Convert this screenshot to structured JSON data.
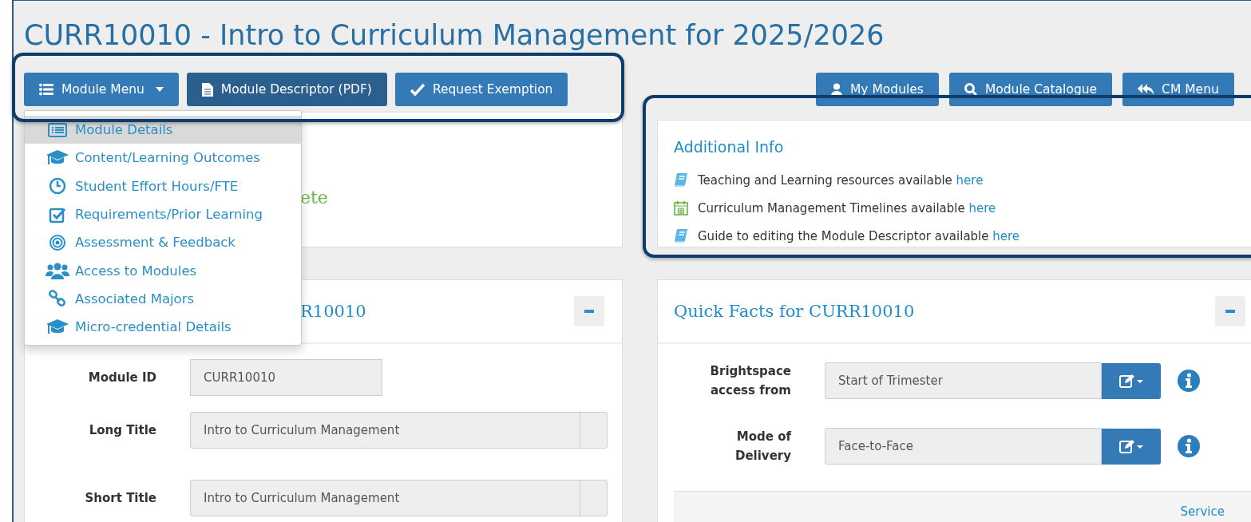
{
  "title": "CURR10010 - Intro to Curriculum Management for 2025/2026",
  "module_menu": {
    "label": "Module Menu",
    "expanded": true,
    "items": [
      {
        "label": "Module Details",
        "selected": true
      },
      {
        "label": "Content/Learning Outcomes",
        "selected": false
      },
      {
        "label": "Student Effort Hours/FTE",
        "selected": false
      },
      {
        "label": "Requirements/Prior Learning",
        "selected": false
      },
      {
        "label": "Assessment & Feedback",
        "selected": false
      },
      {
        "label": "Access to Modules",
        "selected": false
      },
      {
        "label": "Associated Majors",
        "selected": false
      },
      {
        "label": "Micro-credential Details",
        "selected": false
      }
    ]
  },
  "toolbar_buttons": [
    {
      "label": "Module Descriptor (PDF)",
      "active": true
    },
    {
      "label": "Request Exemption",
      "active": false
    }
  ],
  "nav_buttons": [
    {
      "label": "My Modules"
    },
    {
      "label": "Module Catalogue"
    },
    {
      "label": "CM Menu"
    }
  ],
  "status_card": {
    "text": "ete"
  },
  "details_panel": {
    "heading": "R10010",
    "fields": [
      {
        "label": "Module ID",
        "value": "CURR10010",
        "kind": "short"
      },
      {
        "label": "Long Title",
        "value": "Intro to Curriculum Management",
        "kind": "addon"
      },
      {
        "label": "Short Title",
        "value": "Intro to Curriculum Management",
        "kind": "addon"
      }
    ]
  },
  "additional_info": {
    "heading": "Additional Info",
    "items": [
      {
        "text": "Teaching and Learning resources available",
        "link": "here"
      },
      {
        "text": "Curriculum Management Timelines available",
        "link": "here"
      },
      {
        "text": "Guide to editing the Module Descriptor available",
        "link": "here"
      }
    ]
  },
  "quick_facts": {
    "heading": "Quick Facts for CURR10010",
    "fields": [
      {
        "label": "Brightspace access from",
        "value": "Start of Trimester"
      },
      {
        "label": "Mode of Delivery",
        "value": "Face-to-Face"
      }
    ],
    "footer_link": "Service"
  }
}
